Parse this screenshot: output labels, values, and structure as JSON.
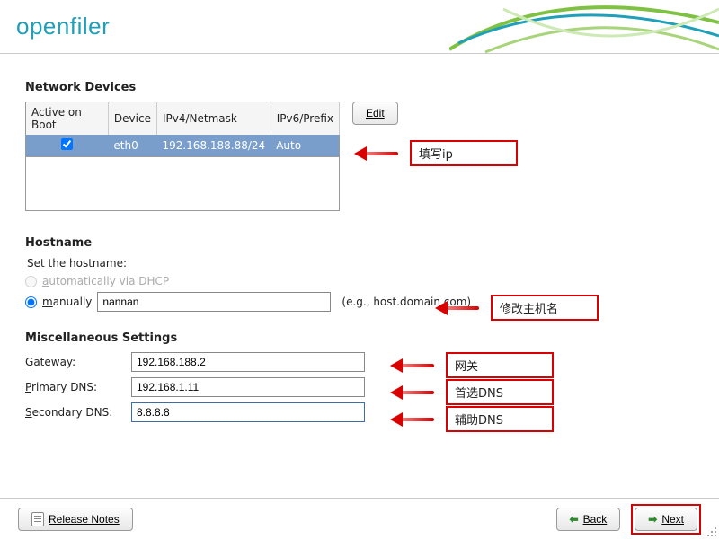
{
  "logo_text": "openfiler",
  "sections": {
    "network_devices": "Network Devices",
    "hostname": "Hostname",
    "misc": "Miscellaneous Settings"
  },
  "net_table": {
    "headers": [
      "Active on Boot",
      "Device",
      "IPv4/Netmask",
      "IPv6/Prefix"
    ],
    "row": {
      "active": true,
      "device": "eth0",
      "ipv4": "192.168.188.88/24",
      "ipv6": "Auto"
    }
  },
  "buttons": {
    "edit": "Edit",
    "release_notes": "Release Notes",
    "back": "Back",
    "next": "Next"
  },
  "hostname": {
    "set_label": "Set the hostname:",
    "auto_label": "automatically via DHCP",
    "manual_label": "manually",
    "manual_value": "nannan",
    "example": "(e.g., host.domain.com)"
  },
  "misc": {
    "gateway_label": "Gateway:",
    "gateway_value": "192.168.188.2",
    "primary_label": "Primary DNS:",
    "primary_value": "192.168.1.11",
    "secondary_label": "Secondary DNS:",
    "secondary_value": "8.8.8.8"
  },
  "annotations": {
    "ip": "填写ip",
    "hostname": "修改主机名",
    "gateway": "网关",
    "primary": "首选DNS",
    "secondary": "辅助DNS"
  }
}
